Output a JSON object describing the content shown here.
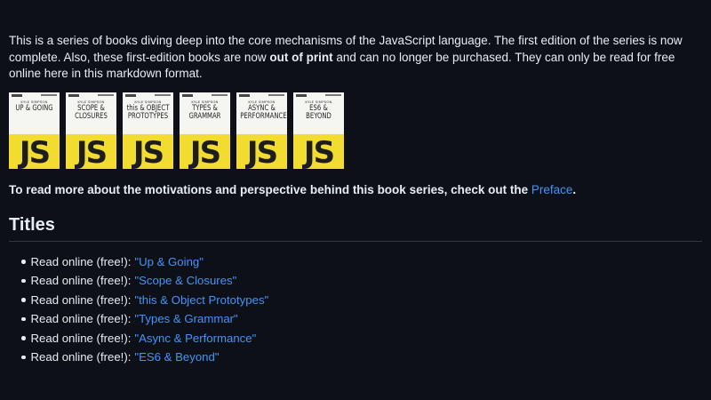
{
  "intro": {
    "text_before": "This is a series of books diving deep into the core mechanisms of the JavaScript language. The first edition of the series is now complete. Also, these first-edition books are now ",
    "bold": "out of print",
    "text_after": " and can no longer be purchased. They can only be read for free online here in this markdown format."
  },
  "covers": [
    {
      "author": "KYLE SIMPSON",
      "title": "UP & GOING",
      "logo": "JS"
    },
    {
      "author": "KYLE SIMPSON",
      "title": "SCOPE & CLOSURES",
      "logo": "JS"
    },
    {
      "author": "KYLE SIMPSON",
      "title": "this & OBJECT PROTOTYPES",
      "logo": "JS"
    },
    {
      "author": "KYLE SIMPSON",
      "title": "TYPES & GRAMMAR",
      "logo": "JS"
    },
    {
      "author": "KYLE SIMPSON",
      "title": "ASYNC & PERFORMANCE",
      "logo": "JS"
    },
    {
      "author": "KYLE SIMPSON",
      "title": "ES6 & BEYOND",
      "logo": "JS"
    }
  ],
  "motivation": {
    "text": "To read more about the motivations and perspective behind this book series, check out the ",
    "link": "Preface",
    "suffix": "."
  },
  "titles_heading": "Titles",
  "titles": [
    {
      "prefix": "Read online (free!):",
      "link": "\"Up & Going\""
    },
    {
      "prefix": "Read online (free!):",
      "link": "\"Scope & Closures\""
    },
    {
      "prefix": "Read online (free!):",
      "link": "\"this & Object Prototypes\""
    },
    {
      "prefix": "Read online (free!):",
      "link": "\"Types & Grammar\""
    },
    {
      "prefix": "Read online (free!):",
      "link": "\"Async & Performance\""
    },
    {
      "prefix": "Read online (free!):",
      "link": "\"ES6 & Beyond\""
    }
  ],
  "colors": {
    "background": "#0d1117",
    "text": "#e6edf3",
    "link": "#4493f8",
    "cover_yellow": "#f2dc2f"
  }
}
